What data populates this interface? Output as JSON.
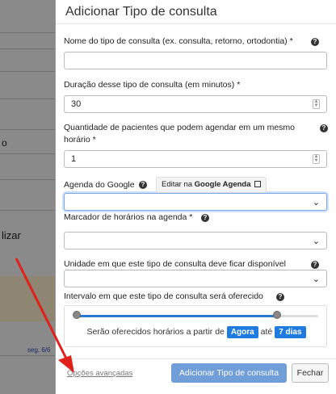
{
  "background": {
    "left_texts": [
      "o",
      "lizar"
    ],
    "left_small": "seg. 6/6"
  },
  "modal": {
    "title": "Adicionar Tipo de consulta",
    "fields": {
      "name": {
        "label": "Nome do tipo de consulta (ex. consulta, retorno, ortodontia) *",
        "value": ""
      },
      "duration": {
        "label": "Duração desse tipo de consulta (em minutos) *",
        "value": "30"
      },
      "patients": {
        "label": "Quantidade de pacientes que podem agendar em um mesmo horário *",
        "value": "1"
      },
      "agenda_google": {
        "label": "Agenda do Google",
        "edit_prefix": "Editar na ",
        "edit_bold": "Google Agenda",
        "value": ""
      },
      "marker": {
        "label": "Marcador de horários na agenda *",
        "value": ""
      },
      "unit": {
        "label": "Unidade em que este tipo de consulta deve ficar disponível",
        "value": ""
      },
      "interval": {
        "label": "Intervalo em que este tipo de consulta será oferecido",
        "text_prefix": "Serão oferecidos horários a partir de",
        "from": "Agora",
        "middle": "até",
        "to": "7 dias",
        "fill_fraction": 0.83
      }
    },
    "footer": {
      "advanced": "Opções avançadas",
      "submit": "Adicionar Tipo de consulta",
      "close": "Fechar"
    }
  },
  "colors": {
    "primary": "#1f7be0",
    "primary_disabled": "#6f9ed8",
    "arrow": "#e0211b"
  }
}
